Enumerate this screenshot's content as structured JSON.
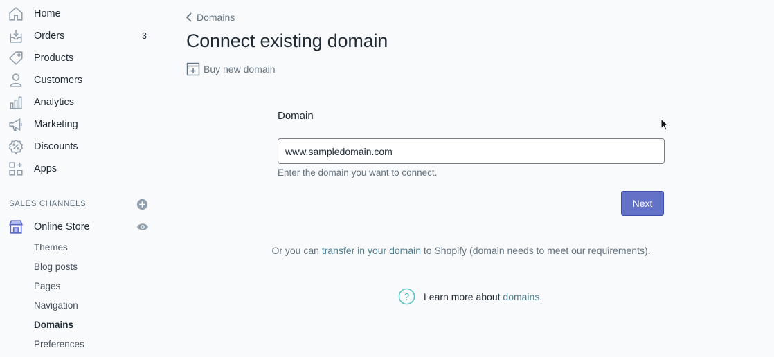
{
  "sidebar": {
    "items": [
      {
        "label": "Home",
        "icon": "home-icon"
      },
      {
        "label": "Orders",
        "icon": "orders-icon",
        "badge": "3"
      },
      {
        "label": "Products",
        "icon": "tag-icon"
      },
      {
        "label": "Customers",
        "icon": "person-icon"
      },
      {
        "label": "Analytics",
        "icon": "bar-chart-icon"
      },
      {
        "label": "Marketing",
        "icon": "megaphone-icon"
      },
      {
        "label": "Discounts",
        "icon": "discount-icon"
      },
      {
        "label": "Apps",
        "icon": "apps-icon"
      }
    ],
    "sales_channels_title": "SALES CHANNELS",
    "online_store": {
      "label": "Online Store",
      "icon": "store-icon"
    },
    "sub_items": [
      "Themes",
      "Blog posts",
      "Pages",
      "Navigation",
      "Domains",
      "Preferences"
    ],
    "active_sub_item": "Domains"
  },
  "main": {
    "breadcrumb": "Domains",
    "title": "Connect existing domain",
    "secondary_action": "Buy new domain",
    "form": {
      "label": "Domain",
      "value": "www.sampledomain.com",
      "help": "Enter the domain you want to connect.",
      "next_label": "Next"
    },
    "transfer": {
      "prefix": "Or you can ",
      "link": "transfer in your domain",
      "suffix": " to Shopify (domain needs to meet our requirements)."
    },
    "learn_more": {
      "prefix": "Learn more about ",
      "link": "domains",
      "suffix": "."
    }
  },
  "colors": {
    "accent": "#6371c7",
    "link": "#2e6b8a",
    "muted": "#637381"
  }
}
